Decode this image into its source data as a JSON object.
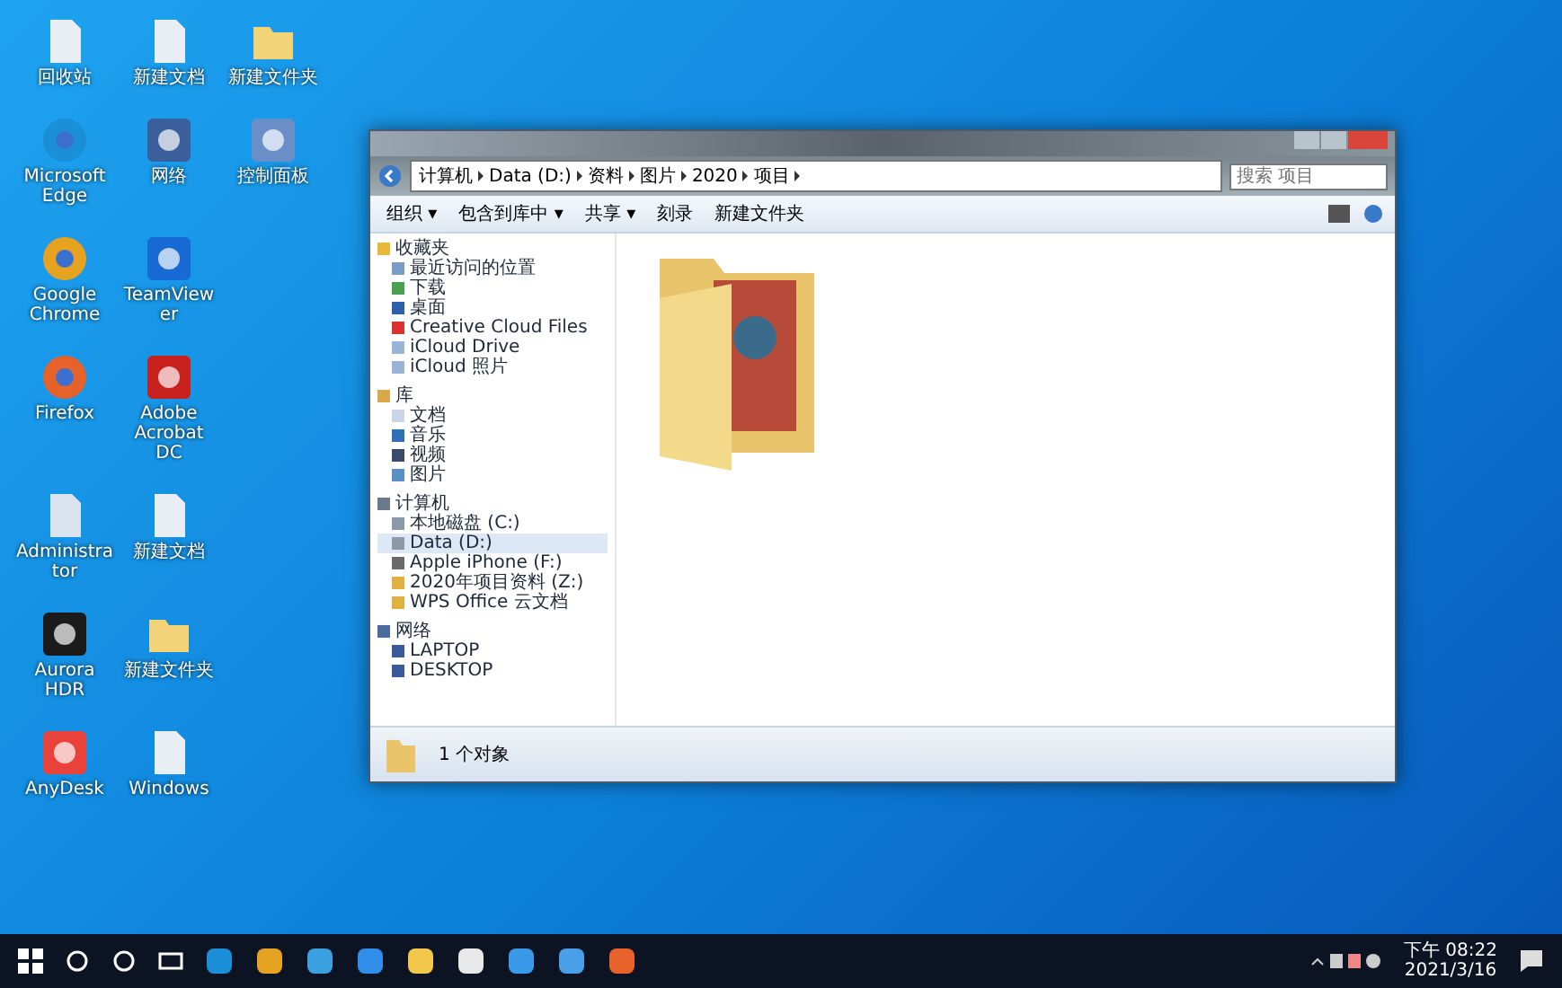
{
  "desktop_rows": [
    [
      {
        "label": "回收站",
        "kind": "file"
      },
      {
        "label": "新建文档",
        "kind": "file"
      },
      {
        "label": "新建文件夹",
        "kind": "folder"
      }
    ],
    [
      {
        "label": "Microsoft Edge",
        "kind": "edge"
      },
      {
        "label": "网络",
        "kind": "network"
      },
      {
        "label": "控制面板",
        "kind": "panel"
      }
    ],
    [
      {
        "label": "Google Chrome",
        "kind": "chrome"
      },
      {
        "label": "TeamViewer",
        "kind": "remote"
      }
    ],
    [
      {
        "label": "Firefox",
        "kind": "firefox"
      },
      {
        "label": "Adobe Acrobat DC",
        "kind": "acrobat"
      }
    ],
    [
      {
        "label": "Administrator",
        "kind": "doc"
      },
      {
        "label": "新建文档",
        "kind": "file"
      }
    ],
    [
      {
        "label": "Aurora HDR",
        "kind": "aurora"
      },
      {
        "label": "新建文件夹",
        "kind": "folder"
      }
    ],
    [
      {
        "label": "AnyDesk",
        "kind": "anydesk"
      },
      {
        "label": "Windows",
        "kind": "file"
      }
    ]
  ],
  "window": {
    "address": [
      "计算机",
      "Data (D:)",
      "资料",
      "图片",
      "2020",
      "项目"
    ],
    "search": {
      "placeholder": "搜索 项目"
    },
    "toolbar": [
      "组织 ▾",
      "包含到库中 ▾",
      "共享 ▾",
      "刻录",
      "新建文件夹"
    ],
    "sidebar": [
      {
        "label": "收藏夹",
        "kind": "star",
        "children": [
          {
            "label": "最近访问的位置",
            "kind": "recent",
            "selected": false
          },
          {
            "label": "下载",
            "kind": "download",
            "selected": false
          },
          {
            "label": "桌面",
            "kind": "desktop",
            "selected": false
          },
          {
            "label": "Creative Cloud Files",
            "kind": "cloud",
            "selected": false
          },
          {
            "label": "iCloud Drive",
            "kind": "icloud",
            "selected": false
          },
          {
            "label": "iCloud 照片",
            "kind": "icloud",
            "selected": false
          }
        ]
      },
      {
        "label": "库",
        "kind": "library",
        "children": [
          {
            "label": "文档",
            "kind": "doc",
            "selected": false
          },
          {
            "label": "音乐",
            "kind": "music",
            "selected": false
          },
          {
            "label": "视频",
            "kind": "video",
            "selected": false
          },
          {
            "label": "图片",
            "kind": "picture",
            "selected": false
          }
        ]
      },
      {
        "label": "计算机",
        "kind": "computer",
        "children": [
          {
            "label": "本地磁盘 (C:)",
            "kind": "drive",
            "selected": false
          },
          {
            "label": "Data (D:)",
            "kind": "drive",
            "selected": true
          },
          {
            "label": "Apple iPhone (F:)",
            "kind": "phone",
            "selected": false
          },
          {
            "label": "2020年项目资料 (Z:)",
            "kind": "netdrive",
            "selected": false
          },
          {
            "label": "WPS Office 云文档",
            "kind": "netdrive",
            "selected": false
          }
        ]
      },
      {
        "label": "网络",
        "kind": "network",
        "children": [
          {
            "label": "LAPTOP",
            "kind": "pc",
            "selected": false
          },
          {
            "label": "DESKTOP",
            "kind": "pc",
            "selected": false
          }
        ]
      }
    ],
    "status": "1 个对象"
  },
  "taskbar": [
    {
      "kind": "start"
    },
    {
      "kind": "search"
    },
    {
      "kind": "cortana"
    },
    {
      "kind": "taskview"
    },
    {
      "kind": "edge"
    },
    {
      "kind": "chrome"
    },
    {
      "kind": "ie"
    },
    {
      "kind": "blue"
    },
    {
      "kind": "explorer"
    },
    {
      "kind": "store"
    },
    {
      "kind": "mail"
    },
    {
      "kind": "window"
    },
    {
      "kind": "firefox"
    }
  ],
  "tray": {
    "time": "下午 08:22",
    "date": "2021/3/16"
  }
}
